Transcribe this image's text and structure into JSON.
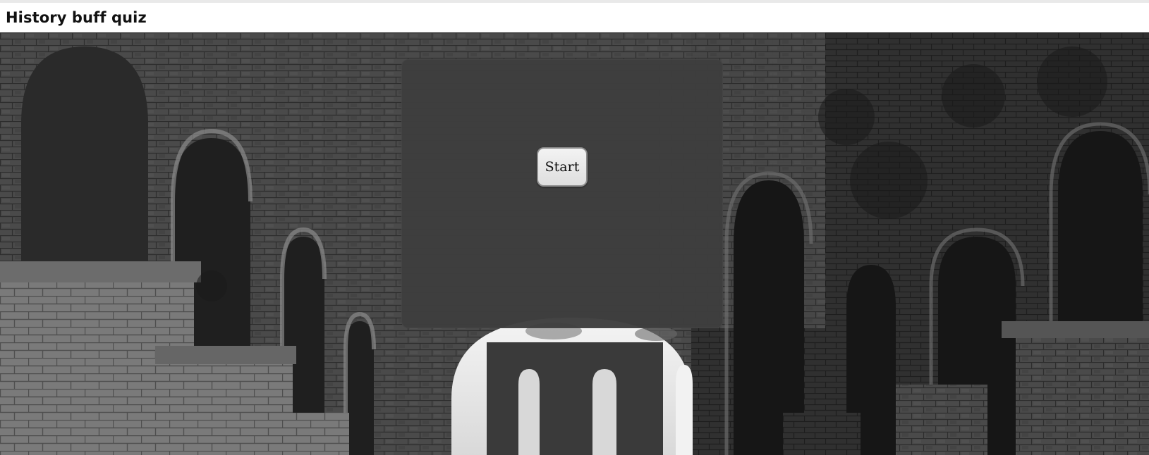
{
  "page": {
    "title": "History buff quiz"
  },
  "quiz": {
    "start_label": "Start"
  },
  "colors": {
    "panel": "#3e3e3e",
    "header": "#ffffff",
    "button": "#ececec"
  }
}
